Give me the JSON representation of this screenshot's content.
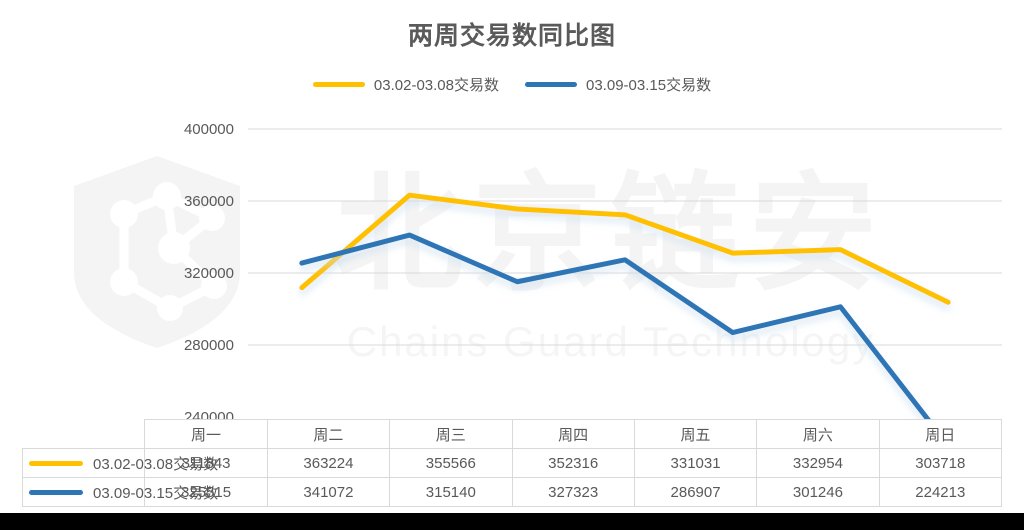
{
  "chart_data": {
    "type": "line",
    "title": "两周交易数同比图",
    "xlabel": "",
    "ylabel": "",
    "categories": [
      "周一",
      "周二",
      "周三",
      "周四",
      "周五",
      "周六",
      "周日"
    ],
    "series": [
      {
        "name": "03.02-03.08交易数",
        "color": "#FFC000",
        "values": [
          311843,
          363224,
          355566,
          352316,
          331031,
          332954,
          303718
        ]
      },
      {
        "name": "03.09-03.15交易数",
        "color": "#2E75B6",
        "values": [
          325515,
          341072,
          315140,
          327323,
          286907,
          301246,
          224213
        ]
      }
    ],
    "ylim": [
      240000,
      400000
    ],
    "yticks": [
      400000,
      360000,
      320000,
      280000,
      240000
    ],
    "ytick_labels": [
      "400000",
      "360000",
      "320000",
      "280000",
      "240000"
    ],
    "grid": true,
    "legend_position": "top",
    "data_table_visible": true
  },
  "watermark": {
    "cn_text": "北京链安",
    "en_text": "Chains Guard Technology",
    "logo_name": "chains-guard-shield-logo"
  },
  "table": {
    "corner_label": "",
    "column_headers": [
      "周一",
      "周二",
      "周三",
      "周四",
      "周五",
      "周六",
      "周日"
    ],
    "rows": [
      {
        "label": "03.02-03.08交易数",
        "color": "#FFC000",
        "cells": [
          "311843",
          "363224",
          "355566",
          "352316",
          "331031",
          "332954",
          "303718"
        ]
      },
      {
        "label": "03.09-03.15交易数",
        "color": "#2E75B6",
        "cells": [
          "325515",
          "341072",
          "315140",
          "327323",
          "286907",
          "301246",
          "224213"
        ]
      }
    ]
  },
  "colors": {
    "series_yellow": "#FFC000",
    "series_blue": "#2E75B6",
    "text": "#595959",
    "gridline": "#d9d9d9",
    "background": "#ffffff",
    "bottom_bar": "#000000"
  }
}
